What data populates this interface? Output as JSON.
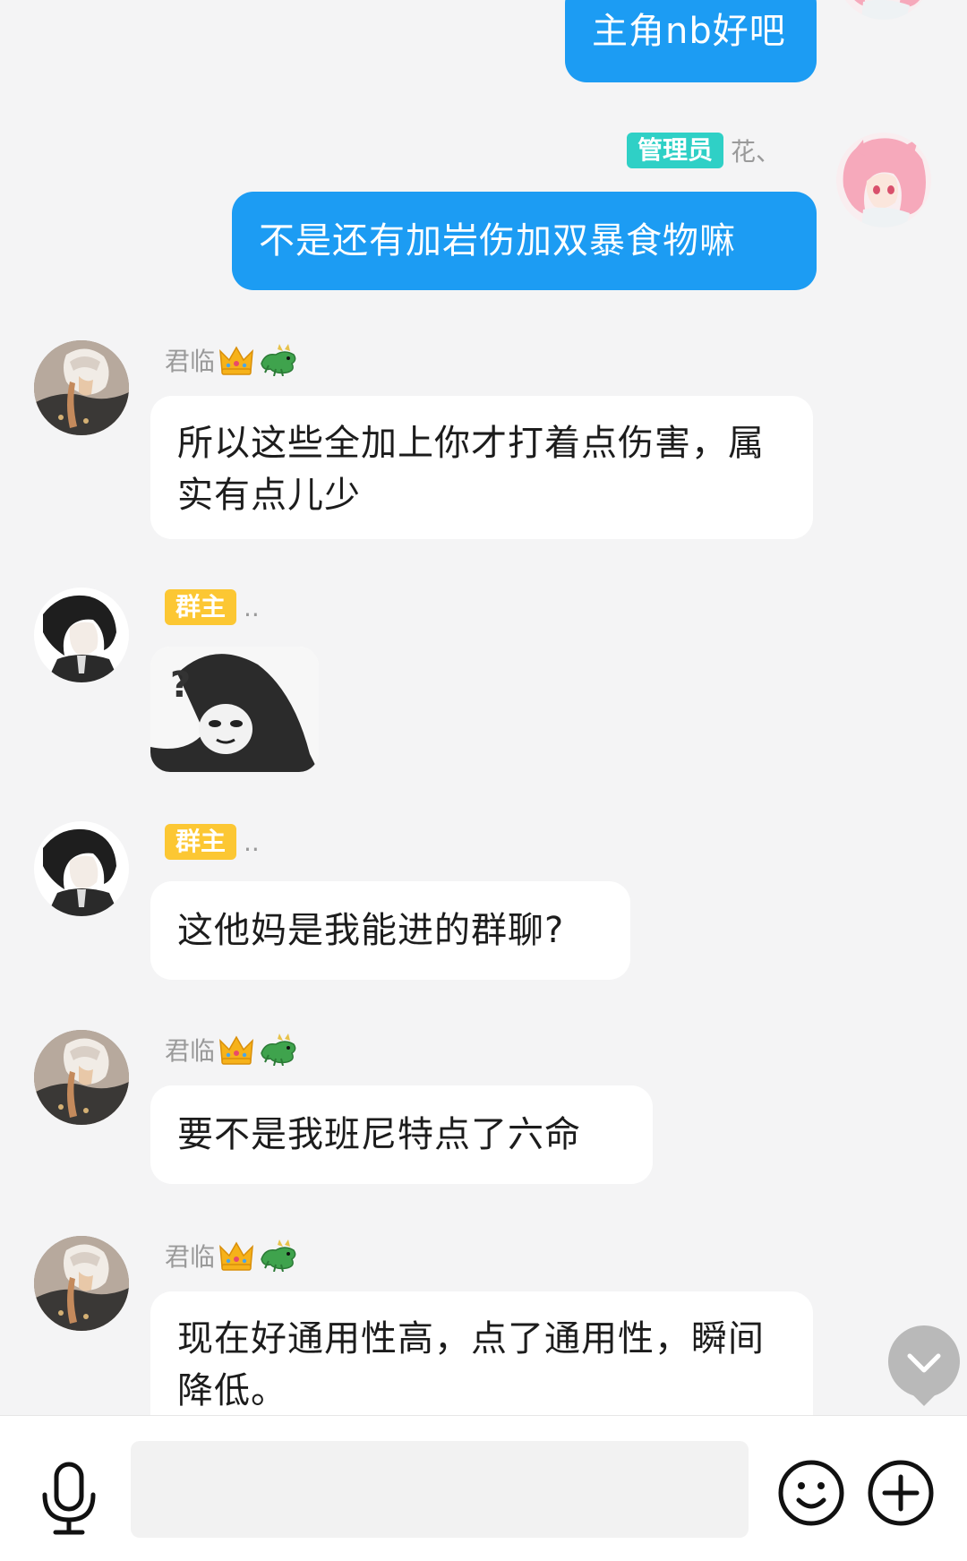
{
  "messages": [
    {
      "side": "right",
      "text": "主角nb好吧"
    },
    {
      "side": "right",
      "sender_badge": "管理员",
      "sender_name": "花、",
      "text": "不是还有加岩伤加双暴食物嘛"
    },
    {
      "side": "left",
      "sender_name": "君临",
      "text": "所以这些全加上你才打着点伤害，属实有点儿少"
    },
    {
      "side": "left",
      "sender_badge": "群主",
      "sender_name": "..",
      "sticker": "panda-meme"
    },
    {
      "side": "left",
      "sender_badge": "群主",
      "sender_name": "..",
      "text": "这他妈是我能进的群聊?"
    },
    {
      "side": "left",
      "sender_name": "君临",
      "text": "要不是我班尼特点了六命"
    },
    {
      "side": "left",
      "sender_name": "君临",
      "text": "现在好通用性高，点了通用性，瞬间降低。"
    }
  ],
  "input": {
    "placeholder": ""
  },
  "icons": {
    "mic": "microphone-icon",
    "emoji": "smiley-face-icon",
    "plus": "plus-circle-icon",
    "scroll": "chevron-down-icon",
    "crown": "crown-emoji",
    "dragon": "dragon-emoji"
  },
  "colors": {
    "right_bubble": "#1c9cf3",
    "left_bubble": "#ffffff",
    "owner_badge": "#fcc733",
    "admin_badge": "#2fd0c6",
    "background": "#f4f4f5"
  }
}
